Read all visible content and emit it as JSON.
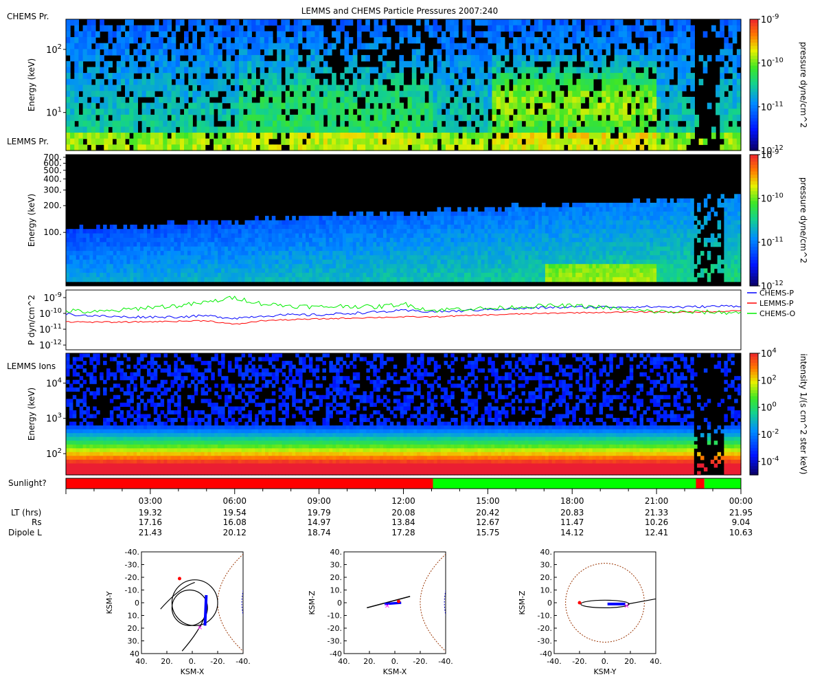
{
  "title": "LEMMS and CHEMS Particle Pressures  2007:240",
  "panel_labels": {
    "chems_pressure": "CHEMS Pr.",
    "lemms_pressure": "LEMMS Pr.",
    "lemms_ions": "LEMMS Ions",
    "sunlight": "Sunlight?"
  },
  "chart_data": [
    {
      "type": "heatmap",
      "name": "CHEMS Pr.",
      "ylabel": "Energy (keV)",
      "yscale": "log",
      "ylim": [
        2.5,
        300
      ],
      "yticks": [
        {
          "v": 10,
          "label": "10",
          "exp": "1"
        },
        {
          "v": 100,
          "label": "10",
          "exp": "2"
        }
      ],
      "colorbar": {
        "label": "pressure dyne/cm^2",
        "scale": "log",
        "range": [
          1e-12,
          1e-09
        ],
        "ticks": [
          {
            "v": 1e-09,
            "label": "10",
            "exp": "-9"
          },
          {
            "v": 1e-10,
            "label": "10",
            "exp": "-10"
          },
          {
            "v": 1e-11,
            "label": "10",
            "exp": "-11"
          },
          {
            "v": 1e-12,
            "label": "10",
            "exp": "-12"
          }
        ]
      }
    },
    {
      "type": "heatmap",
      "name": "LEMMS Pr.",
      "ylabel": "Energy (keV)",
      "yscale": "log",
      "ylim": [
        25,
        750
      ],
      "yticks": [
        {
          "v": 100,
          "label": "100."
        },
        {
          "v": 200,
          "label": "200."
        },
        {
          "v": 300,
          "label": "300."
        },
        {
          "v": 400,
          "label": "400."
        },
        {
          "v": 500,
          "label": "500."
        },
        {
          "v": 600,
          "label": "600."
        },
        {
          "v": 700,
          "label": "700."
        }
      ],
      "colorbar": {
        "label": "pressure dyne/cm^2",
        "scale": "log",
        "range": [
          1e-12,
          1e-09
        ],
        "ticks": [
          {
            "v": 1e-09,
            "label": "10",
            "exp": "-9"
          },
          {
            "v": 1e-10,
            "label": "10",
            "exp": "-10"
          },
          {
            "v": 1e-11,
            "label": "10",
            "exp": "-11"
          },
          {
            "v": 1e-12,
            "label": "10",
            "exp": "-12"
          }
        ]
      }
    },
    {
      "type": "line",
      "ylabel": "P dyn/cm^2",
      "yscale": "log",
      "ylim": [
        5e-13,
        3e-09
      ],
      "yticks": [
        {
          "v": 1e-09,
          "label": "10",
          "exp": "-9"
        },
        {
          "v": 1e-10,
          "label": "10",
          "exp": "-10"
        },
        {
          "v": 1e-11,
          "label": "10",
          "exp": "-11"
        },
        {
          "v": 1e-12,
          "label": "10",
          "exp": "-12"
        }
      ],
      "xlim_hours": [
        0,
        24
      ],
      "series": [
        {
          "name": "CHEMS-P",
          "color": "#0000ff",
          "x": [
            0,
            1,
            2,
            3,
            4,
            5,
            6,
            7,
            8,
            9,
            10,
            11,
            12,
            13,
            14,
            15,
            16,
            17,
            18,
            19,
            20,
            21,
            22,
            23,
            24
          ],
          "y": [
            9e-11,
            7e-11,
            6e-11,
            6e-11,
            6e-11,
            7e-11,
            5e-11,
            7e-11,
            8e-11,
            8e-11,
            1e-10,
            1.2e-10,
            1.5e-10,
            1.3e-10,
            1.4e-10,
            1.8e-10,
            2e-10,
            2.3e-10,
            2.5e-10,
            2.5e-10,
            2.6e-10,
            2.6e-10,
            2.5e-10,
            2.8e-10,
            3e-10
          ]
        },
        {
          "name": "LEMMS-P",
          "color": "#ff0000",
          "x": [
            0,
            1,
            2,
            3,
            4,
            5,
            6,
            7,
            8,
            9,
            10,
            11,
            12,
            13,
            14,
            15,
            16,
            17,
            18,
            19,
            20,
            21,
            22,
            23,
            24
          ],
          "y": [
            3e-11,
            2.8e-11,
            2.8e-11,
            3e-11,
            3.2e-11,
            3.5e-11,
            2e-11,
            3.5e-11,
            4e-11,
            4.5e-11,
            5e-11,
            5.5e-11,
            6e-11,
            6e-11,
            7e-11,
            8e-11,
            9e-11,
            1e-10,
            1.1e-10,
            1.15e-10,
            1.2e-10,
            1.25e-10,
            1.2e-10,
            1.3e-10,
            1.5e-10
          ]
        },
        {
          "name": "CHEMS-O",
          "color": "#00ee00",
          "x": [
            0,
            1,
            2,
            3,
            4,
            5,
            6,
            7,
            8,
            9,
            10,
            11,
            12,
            13,
            14,
            15,
            16,
            17,
            18,
            19,
            20,
            21,
            22,
            23,
            24
          ],
          "y": [
            1.5e-10,
            1.2e-10,
            1.6e-10,
            2.5e-10,
            3e-10,
            5e-10,
            1e-09,
            4e-10,
            3e-10,
            2.5e-10,
            3e-10,
            2.5e-10,
            4e-10,
            1.5e-10,
            2e-10,
            2e-10,
            2.5e-10,
            3e-10,
            3e-10,
            2.5e-10,
            1.6e-10,
            1.3e-10,
            1.2e-10,
            1.2e-10,
            1.1e-10
          ]
        }
      ]
    },
    {
      "type": "heatmap",
      "name": "LEMMS Ions",
      "ylabel": "Energy (keV)",
      "yscale": "log",
      "ylim": [
        25,
        70000
      ],
      "yticks": [
        {
          "v": 100,
          "label": "10",
          "exp": "2"
        },
        {
          "v": 1000,
          "label": "10",
          "exp": "3"
        },
        {
          "v": 10000,
          "label": "10",
          "exp": "4"
        }
      ],
      "colorbar": {
        "label": "intensity 1/(s cm^2 ster keV)",
        "scale": "log",
        "range": [
          1e-05,
          10000.0
        ],
        "ticks": [
          {
            "v": 10000.0,
            "label": "10",
            "exp": "4"
          },
          {
            "v": 100.0,
            "label": "10",
            "exp": "2"
          },
          {
            "v": 1,
            "label": "10",
            "exp": "0"
          },
          {
            "v": 0.01,
            "label": "10",
            "exp": "-2"
          },
          {
            "v": 0.0001,
            "label": "10",
            "exp": "-4"
          }
        ]
      }
    },
    {
      "type": "bar",
      "name": "Sunlight?",
      "segments": [
        {
          "start_h": 0,
          "end_h": 13.05,
          "color": "#ff0000"
        },
        {
          "start_h": 13.05,
          "end_h": 22.4,
          "color": "#00ff00"
        },
        {
          "start_h": 22.4,
          "end_h": 22.7,
          "color": "#ff0000"
        },
        {
          "start_h": 22.7,
          "end_h": 24,
          "color": "#00ff00"
        }
      ]
    }
  ],
  "time_axis": {
    "row_labels": [
      "LT (hrs)",
      "Rs",
      "Dipole L"
    ],
    "ticks": [
      {
        "h": 3,
        "time": "03:00",
        "lt": "19.32",
        "rs": "17.16",
        "l": "21.43"
      },
      {
        "h": 6,
        "time": "06:00",
        "lt": "19.54",
        "rs": "16.08",
        "l": "20.12"
      },
      {
        "h": 9,
        "time": "09:00",
        "lt": "19.79",
        "rs": "14.97",
        "l": "18.74"
      },
      {
        "h": 12,
        "time": "12:00",
        "lt": "20.08",
        "rs": "13.84",
        "l": "17.28"
      },
      {
        "h": 15,
        "time": "15:00",
        "lt": "20.42",
        "rs": "12.67",
        "l": "15.75"
      },
      {
        "h": 18,
        "time": "18:00",
        "lt": "20.83",
        "rs": "11.47",
        "l": "14.12"
      },
      {
        "h": 21,
        "time": "21:00",
        "lt": "21.33",
        "rs": "10.26",
        "l": "12.41"
      },
      {
        "h": 24,
        "time": "00:00",
        "lt": "21.95",
        "rs": "9.04",
        "l": "10.63"
      }
    ]
  },
  "orbit_plots": [
    {
      "xlabel": "KSM-X",
      "ylabel": "KSM-Y",
      "xticks": [
        "40.",
        "20.",
        "0.",
        "-20.",
        "-40."
      ],
      "yticks": [
        "-40.",
        "-30.",
        "-20.",
        "-10.",
        "0",
        "10.",
        "20.",
        "30.",
        "40"
      ]
    },
    {
      "xlabel": "KSM-X",
      "ylabel": "KSM-Z",
      "xticks": [
        "40.",
        "20.",
        "0.",
        "-20.",
        "-40."
      ],
      "yticks": [
        "40.",
        "30.",
        "20.",
        "10.",
        "0",
        "-10.",
        "-20.",
        "-30.",
        "-40"
      ]
    },
    {
      "xlabel": "KSM-Y",
      "ylabel": "KSM-Z",
      "xticks": [
        "-40.",
        "-20.",
        "0.",
        "20.",
        "40."
      ],
      "yticks": [
        "40.",
        "30.",
        "20.",
        "10.",
        "0",
        "-10.",
        "-20.",
        "-30.",
        "-40"
      ]
    }
  ]
}
